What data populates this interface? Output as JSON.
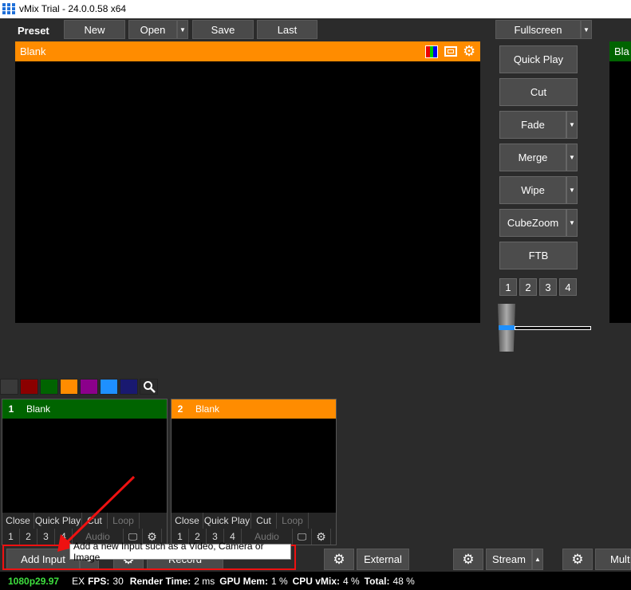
{
  "window": {
    "title": "vMix Trial - 24.0.0.58 x64"
  },
  "toolbar": {
    "preset_label": "Preset",
    "new_label": "New",
    "open_label": "Open",
    "save_label": "Save",
    "last_label": "Last",
    "fullscreen_label": "Fullscreen"
  },
  "preview": {
    "title": "Blank"
  },
  "program": {
    "title": "Bla"
  },
  "transitions": {
    "quick_play": "Quick Play",
    "cut": "Cut",
    "fade": "Fade",
    "merge": "Merge",
    "wipe": "Wipe",
    "cubezoom": "CubeZoom",
    "ftb": "FTB",
    "numbers": [
      "1",
      "2",
      "3",
      "4"
    ]
  },
  "colors": {
    "swatches": [
      "#3a3a3a",
      "#8b0000",
      "#006400",
      "#ff8c00",
      "#8b008b",
      "#1e90ff",
      "#191970"
    ],
    "accent_orange": "#ff8c00",
    "accent_green": "#006400"
  },
  "inputs": [
    {
      "number": "1",
      "name": "Blank",
      "color": "#006400"
    },
    {
      "number": "2",
      "name": "Blank",
      "color": "#ff8c00"
    }
  ],
  "input_controls": {
    "close": "Close",
    "quick_play": "Quick Play",
    "cut": "Cut",
    "loop": "Loop",
    "numbers": [
      "1",
      "2",
      "3",
      "4"
    ],
    "audio": "Audio"
  },
  "bottom": {
    "add_input": "Add Input",
    "record": "Record",
    "external": "External",
    "stream": "Stream",
    "multi": "Multi"
  },
  "tooltip": {
    "text": "Add a new Input such as a Video, Camera or Image"
  },
  "status": {
    "format": "1080p29.97",
    "ex": "EX",
    "fps_label": "FPS:",
    "fps_value": "30",
    "render_label": "Render Time:",
    "render_value": "2 ms",
    "gpu_label": "GPU Mem:",
    "gpu_value": "1 %",
    "cpu_label": "CPU vMix:",
    "cpu_value": "4 %",
    "total_label": "Total:",
    "total_value": "48 %"
  },
  "tbar": {
    "position": 0
  }
}
